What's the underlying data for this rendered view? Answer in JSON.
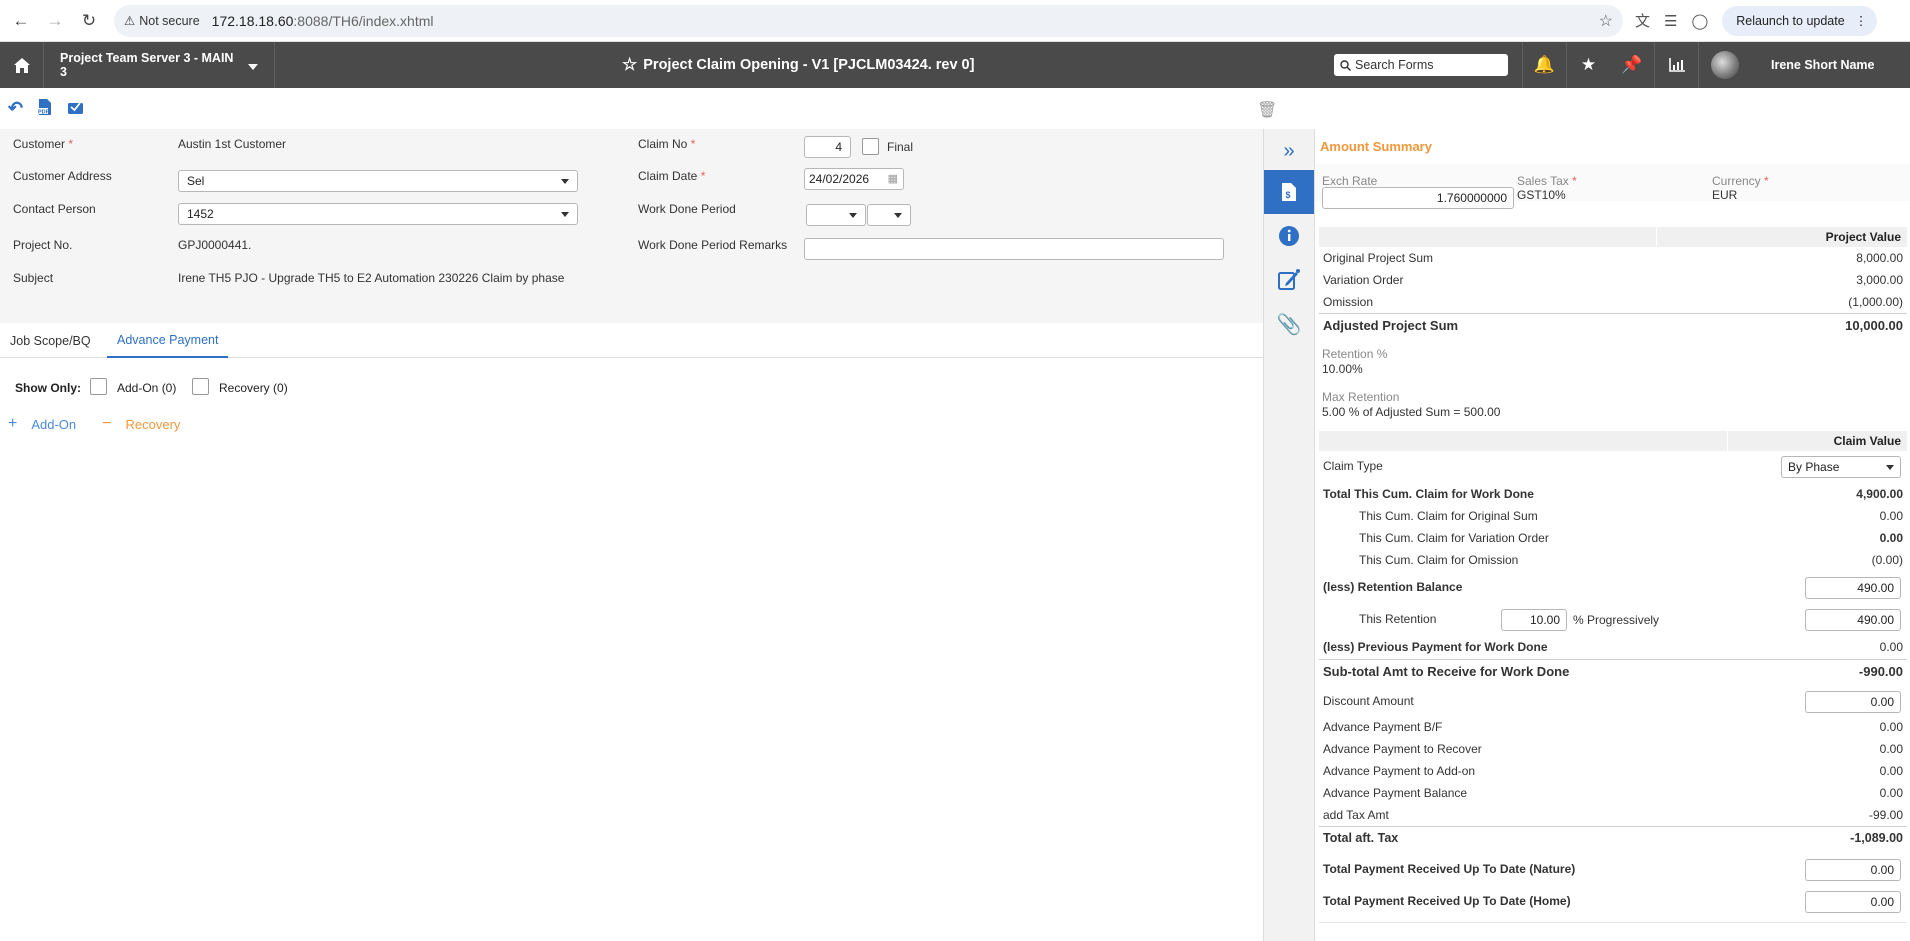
{
  "browser": {
    "not_secure": "Not secure",
    "url_host": "172.18.18.60",
    "url_path": ":8088/TH6/index.xhtml",
    "relaunch": "Relaunch to update"
  },
  "header": {
    "server": "Project Team Server 3 - MAIN 3",
    "title": "Project Claim Opening - V1 [PJCLM03424. rev 0]",
    "search_placeholder": "Search Forms",
    "user": "Irene Short Name"
  },
  "form": {
    "customer_label": "Customer",
    "customer_value": "Austin 1st Customer",
    "customer_address_label": "Customer Address",
    "customer_address_value": "Sel",
    "contact_person_label": "Contact Person",
    "contact_person_value": "1452",
    "project_no_label": "Project No.",
    "project_no_value": "GPJ0000441.",
    "subject_label": "Subject",
    "subject_value": "Irene TH5 PJO - Upgrade TH5 to E2 Automation 230226 Claim by phase",
    "claim_no_label": "Claim No",
    "claim_no_value": "4",
    "final_label": "Final",
    "claim_date_label": "Claim Date",
    "claim_date_value": "24/02/2026",
    "work_done_period_label": "Work Done Period",
    "work_done_remarks_label": "Work Done Period Remarks",
    "work_done_remarks_value": ""
  },
  "tabs": [
    "Job Scope/BQ",
    "Advance Payment"
  ],
  "advance": {
    "show_only": "Show Only:",
    "addon_filter": "Add-On (0)",
    "recovery_filter": "Recovery (0)",
    "addon_btn": "Add-On",
    "recovery_btn": "Recovery"
  },
  "summary": {
    "title": "Amount Summary",
    "exch_rate_label": "Exch Rate",
    "exch_rate_value": "1.760000000",
    "sales_tax_label": "Sales Tax",
    "sales_tax_value": "GST10%",
    "currency_label": "Currency",
    "currency_value": "EUR",
    "project_value_header": "Project Value",
    "original_project_sum": {
      "label": "Original Project Sum",
      "value": "8,000.00"
    },
    "variation_order": {
      "label": "Variation Order",
      "value": "3,000.00"
    },
    "omission": {
      "label": "Omission",
      "value": "(1,000.00)"
    },
    "adjusted_project_sum": {
      "label": "Adjusted Project Sum",
      "value": "10,000.00"
    },
    "retention_pct_label": "Retention %",
    "retention_pct_value": "10.00%",
    "max_retention_label": "Max Retention",
    "max_retention_value": "5.00 % of Adjusted Sum = 500.00",
    "claim_value_header": "Claim Value",
    "claim_type_label": "Claim Type",
    "claim_type_value": "By Phase",
    "total_cum_claim": {
      "label": "Total This Cum. Claim for Work Done",
      "value": "4,900.00"
    },
    "cum_original": {
      "label": "This Cum. Claim for Original Sum",
      "value": "0.00"
    },
    "cum_variation": {
      "label": "This Cum. Claim for Variation Order",
      "value": "0.00"
    },
    "cum_omission": {
      "label": "This Cum. Claim for Omission",
      "value": "(0.00)"
    },
    "retention_balance": {
      "label": "(less) Retention Balance",
      "value": "490.00"
    },
    "this_retention_label": "This Retention",
    "this_retention_pct": "10.00",
    "progressively_label": "% Progressively",
    "this_retention_value": "490.00",
    "previous_payment": {
      "label": "(less) Previous Payment for Work Done",
      "value": "0.00"
    },
    "subtotal": {
      "label": "Sub-total Amt to Receive for Work Done",
      "value": "-990.00"
    },
    "discount": {
      "label": "Discount Amount",
      "value": "0.00"
    },
    "adv_bf": {
      "label": "Advance Payment B/F",
      "value": "0.00"
    },
    "adv_recover": {
      "label": "Advance Payment to Recover",
      "value": "0.00"
    },
    "adv_addon": {
      "label": "Advance Payment to Add-on",
      "value": "0.00"
    },
    "adv_balance": {
      "label": "Advance Payment Balance",
      "value": "0.00"
    },
    "add_tax": {
      "label": "add Tax Amt",
      "value": "-99.00"
    },
    "total_aft_tax": {
      "label": "Total aft. Tax",
      "value": "-1,089.00"
    },
    "total_received_nature": {
      "label": "Total Payment Received Up To Date (Nature)",
      "value": "0.00"
    },
    "total_received_home": {
      "label": "Total Payment Received Up To Date (Home)",
      "value": "0.00"
    }
  },
  "colors": {
    "accent": "#2f6fc4",
    "header_bg": "#4a4a4a",
    "summary_title": "#f0983a",
    "required": "#e0625a"
  }
}
